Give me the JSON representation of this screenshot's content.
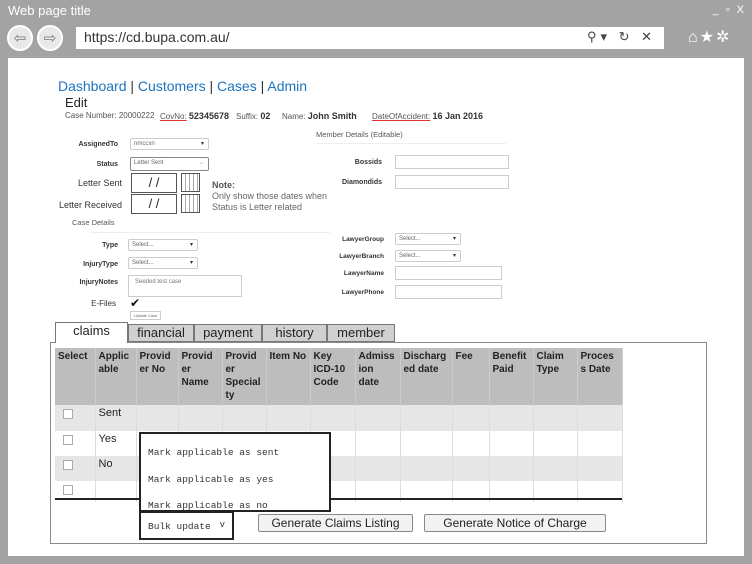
{
  "browser": {
    "title": "Web page title",
    "window_controls": "_ ▫ X",
    "url": "https://cd.bupa.com.au/",
    "addr_icons": "⚲▾ ↻ ✕",
    "tools": "⌂★✲"
  },
  "nav": {
    "items": [
      "Dashboard",
      "Customers",
      "Cases",
      "Admin"
    ],
    "sep": "|"
  },
  "edit": "Edit",
  "meta": {
    "case_label": "Case Number:",
    "case_value": "20000222",
    "covno_label": "CovNo:",
    "covno_value": "52345678",
    "suffix_label": "Suffix:",
    "suffix_value": "02",
    "name_label": "Name:",
    "name_value": "John Smith",
    "doa_label": "DateOfAccident:",
    "doa_value": "16 Jan 2016"
  },
  "member_details": "Member Details (Editable)",
  "form": {
    "assigned_label": "AssignedTo",
    "assigned_value": "nmccxn",
    "status_label": "Status",
    "status_value": "Letter Sent",
    "letter_sent_label": "Letter Sent",
    "letter_received_label": "Letter Received",
    "date_placeholder": "/ /",
    "note_title": "Note:",
    "note_line1": "Only show those dates when",
    "note_line2": "Status is Letter related",
    "bossids_label": "Bossids",
    "diamondids_label": "Diamondids",
    "case_details": "Case Details",
    "type_label": "Type",
    "type_value": "Select...",
    "injurytype_label": "InjuryType",
    "injurytype_value": "Select...",
    "injurynotes_label": "InjuryNotes",
    "injurynotes_value": "Seeded test case",
    "efiles_label": "E-Files",
    "update_case": "Update Case",
    "lawyergroup_label": "LawyerGroup",
    "lawyergroup_value": "Select...",
    "lawyerbranch_label": "LawyerBranch",
    "lawyerbranch_value": "Select...",
    "lawyername_label": "LawyerName",
    "lawyerphone_label": "LawyerPhone"
  },
  "tabs": [
    "claims",
    "financial",
    "payment",
    "history",
    "member"
  ],
  "table": {
    "headers": [
      "Select",
      "Applic able",
      "Provid er No",
      "Provid er Name",
      "Provid er Special ty",
      "Item No",
      "Key ICD-10 Code",
      "Admiss ion date",
      "Discharg ed date",
      "Fee",
      "Benefit Paid",
      "Claim Type",
      "Proces s Date"
    ],
    "rows": [
      {
        "applicable": "Sent"
      },
      {
        "applicable": "Yes"
      },
      {
        "applicable": "No"
      },
      {
        "applicable": ""
      }
    ]
  },
  "bulk_menu": [
    "Mark applicable as sent",
    "Mark applicable as yes",
    "Mark applicable as no"
  ],
  "bulk_select": "Bulk update",
  "bulk_chevron": "v",
  "buttons": {
    "claims_listing": "Generate Claims Listing",
    "notice_of_charge": "Generate Notice of Charge"
  }
}
